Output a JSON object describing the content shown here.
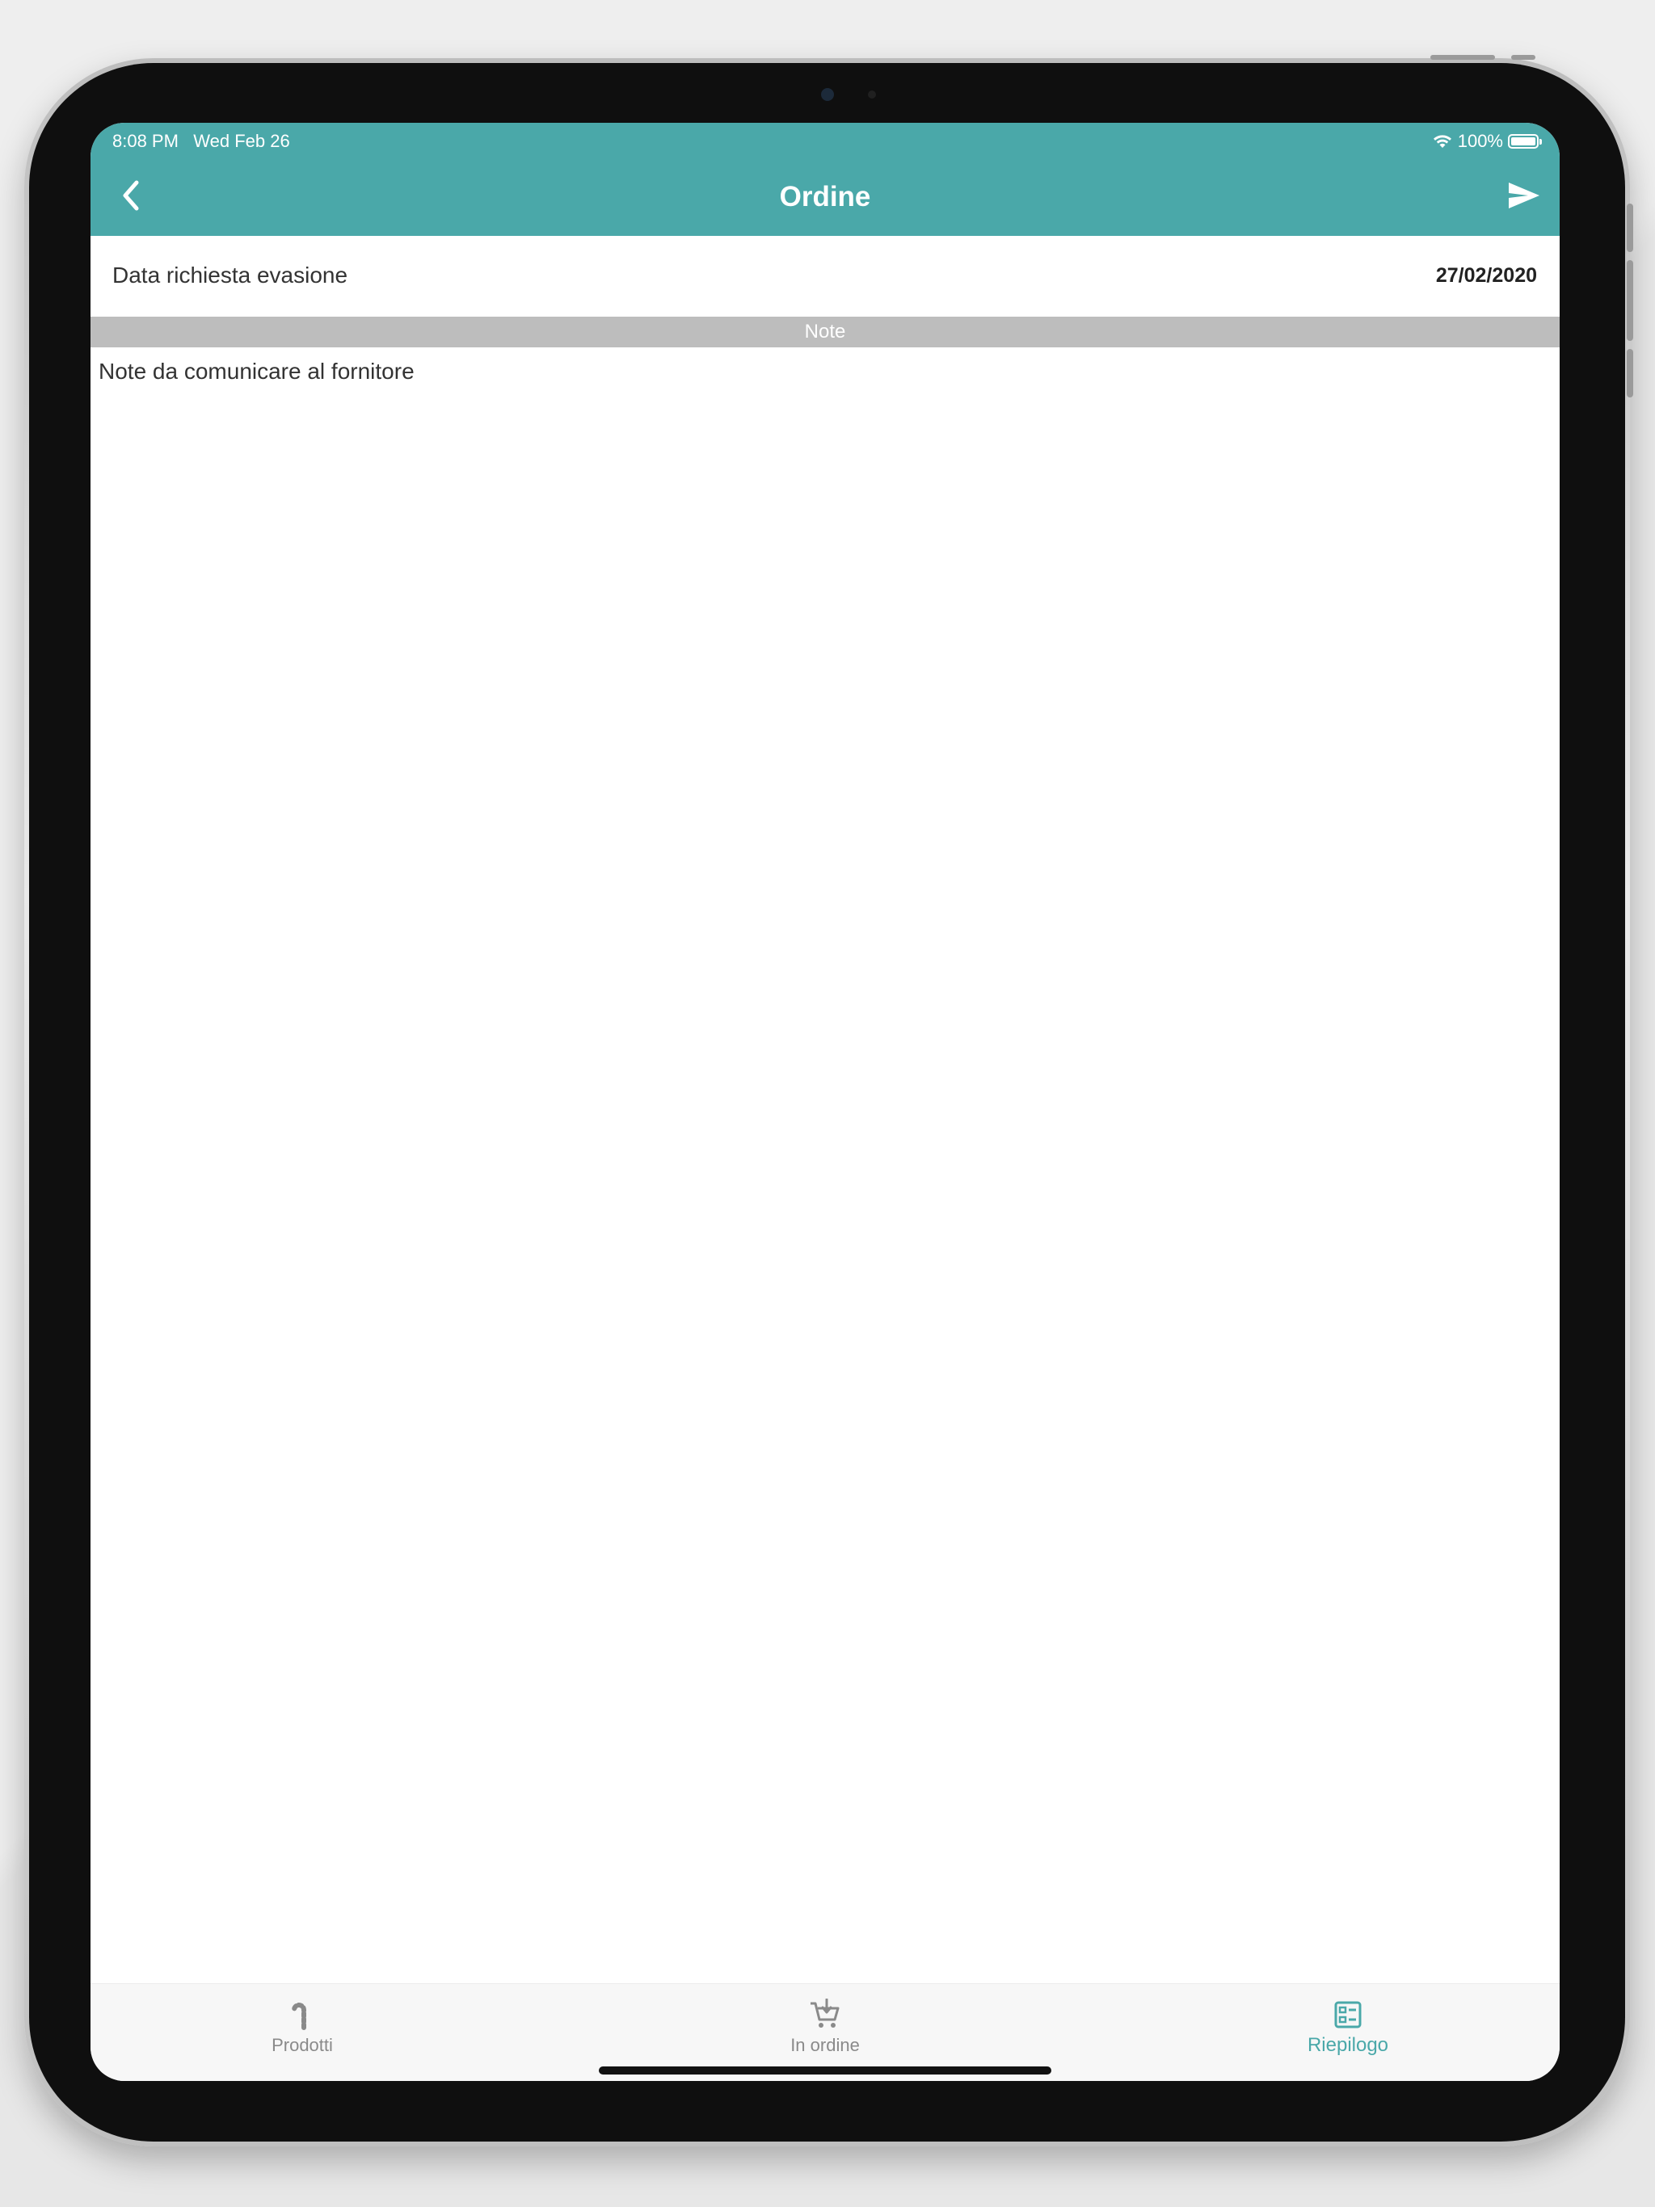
{
  "status_bar": {
    "time": "8:08 PM",
    "date": "Wed Feb 26",
    "battery_text": "100%",
    "battery_level": 1.0
  },
  "header": {
    "title": "Ordine",
    "back_icon": "chevron-left-icon",
    "send_icon": "send-icon",
    "background_color": "#4aa8a9"
  },
  "order": {
    "date_label": "Data richiesta evasione",
    "date_value": "27/02/2020"
  },
  "notes": {
    "section_title": "Note",
    "placeholder": "Note da comunicare al fornitore",
    "value": ""
  },
  "tabs": [
    {
      "label": "Prodotti",
      "icon": "candy-cane-icon",
      "active": false
    },
    {
      "label": "In ordine",
      "icon": "cart-download-icon",
      "active": false
    },
    {
      "label": "Riepilogo",
      "icon": "summary-icon",
      "active": true
    }
  ],
  "colors": {
    "accent": "#4aa8a9",
    "section_header": "#bdbdbd",
    "tab_inactive": "#8a8a8a"
  }
}
